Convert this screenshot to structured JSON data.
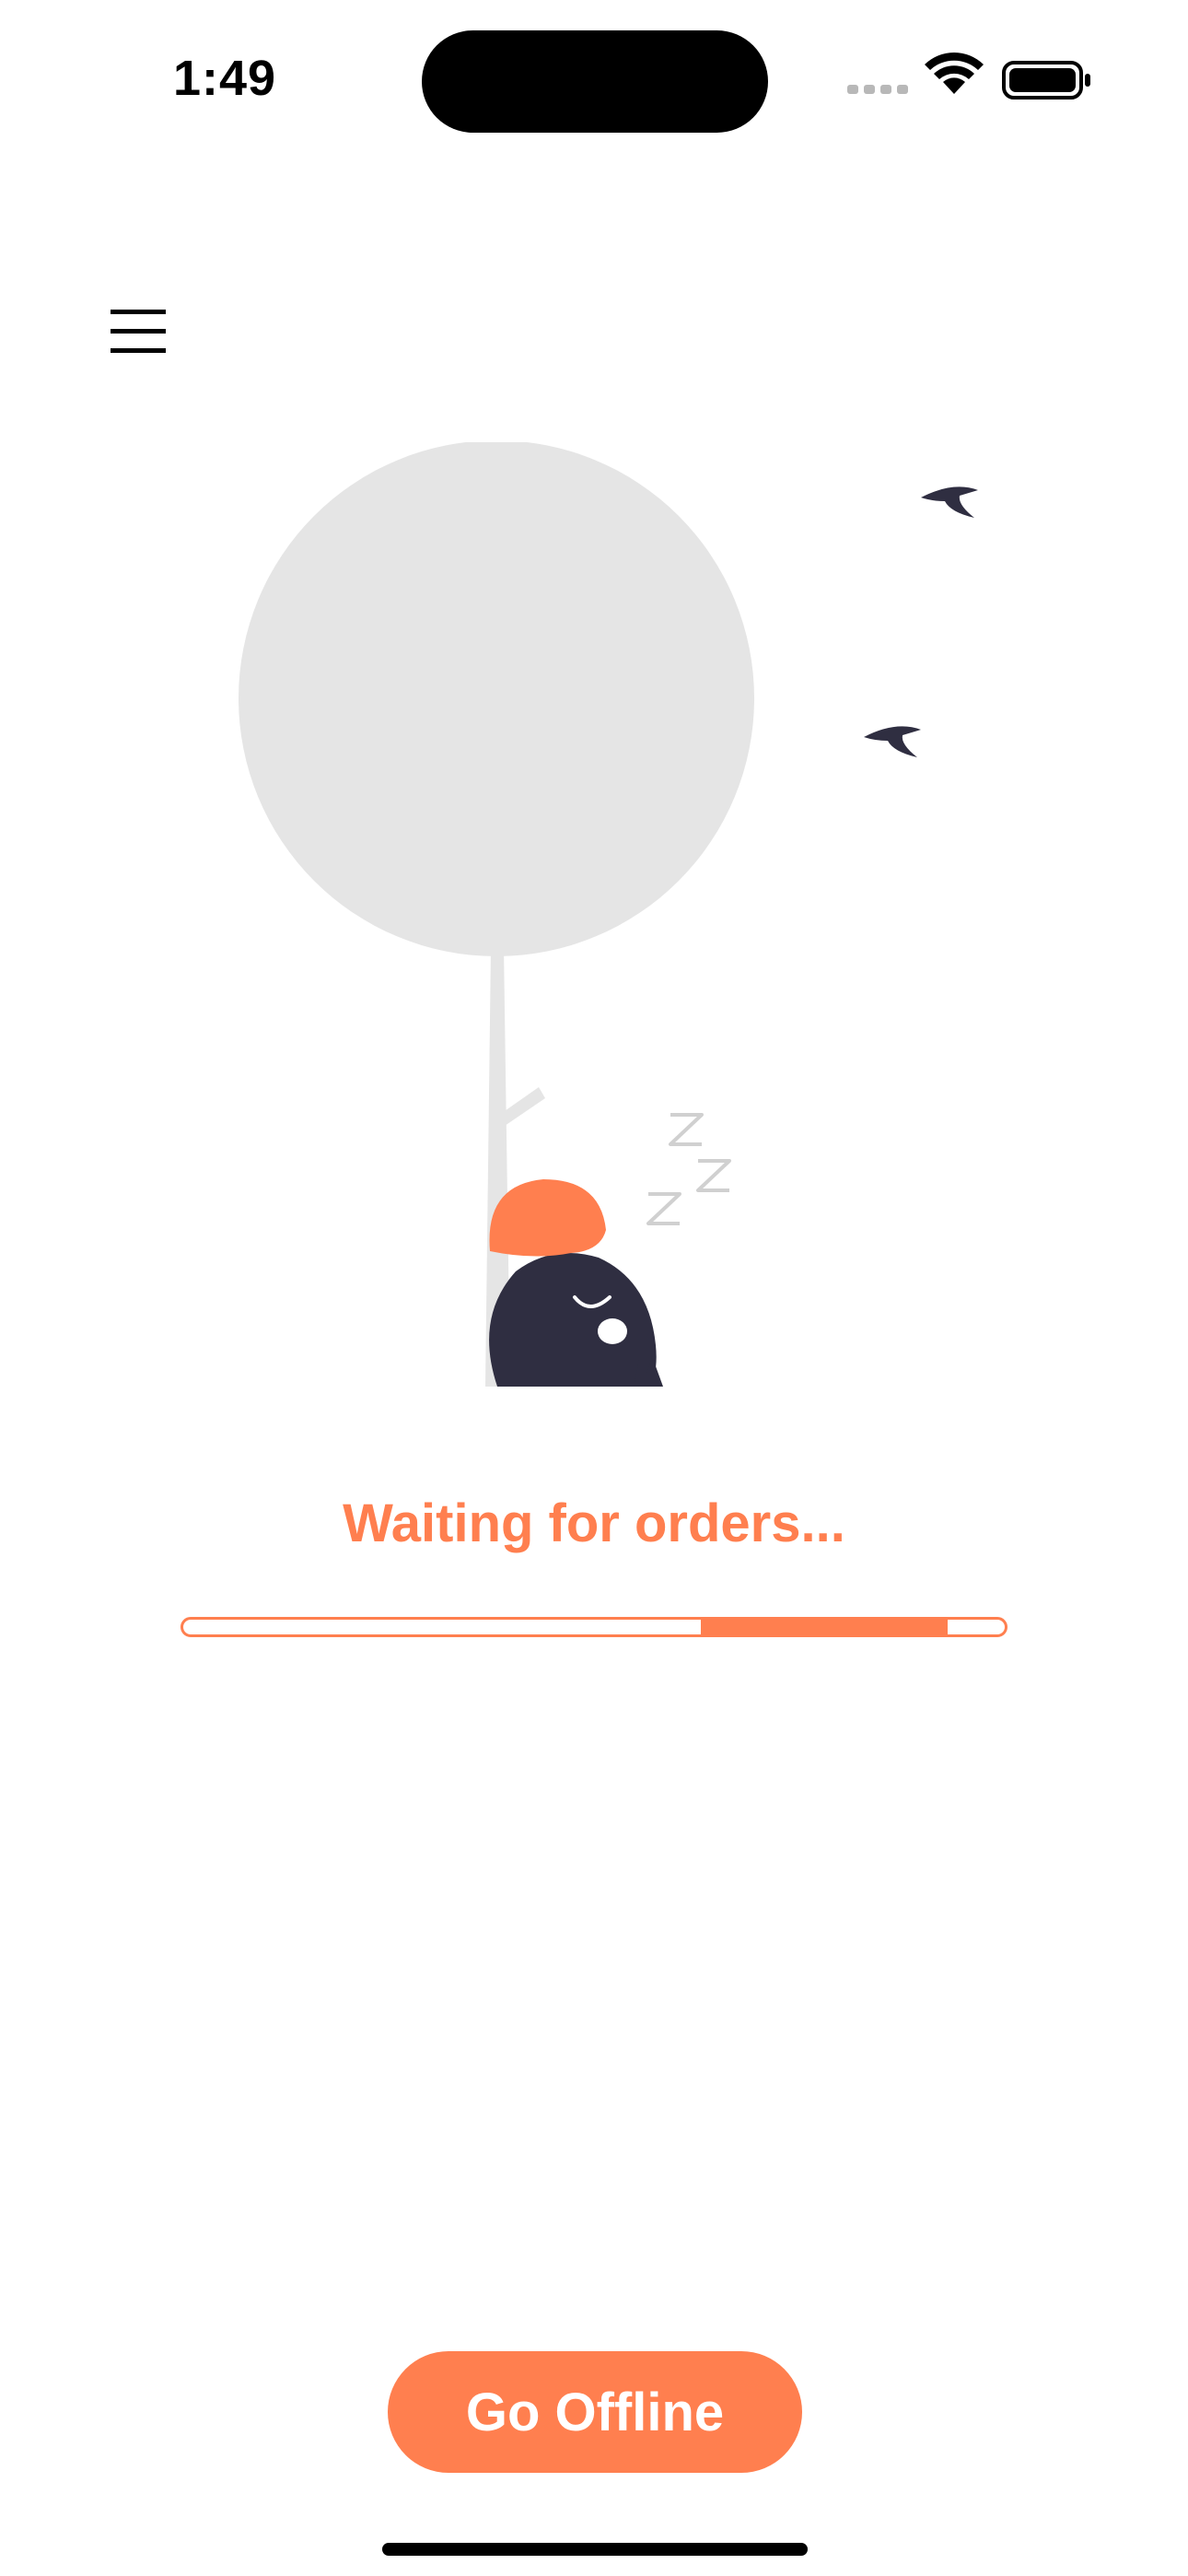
{
  "status_bar": {
    "time": "1:49"
  },
  "header": {
    "menu_icon": "hamburger-menu-icon"
  },
  "illustration": {
    "sleep_marks": [
      "Z",
      "Z",
      "Z"
    ],
    "icon": "sleeping-character-under-tree-illustration"
  },
  "main": {
    "waiting_text": "Waiting for orders...",
    "progress_segment": {
      "start_fraction": 0.63,
      "end_fraction": 0.93
    }
  },
  "footer": {
    "offline_button_label": "Go Offline"
  },
  "colors": {
    "accent": "#FF7F4F",
    "dark": "#2F2E41",
    "tree": "#E5E5E5"
  }
}
